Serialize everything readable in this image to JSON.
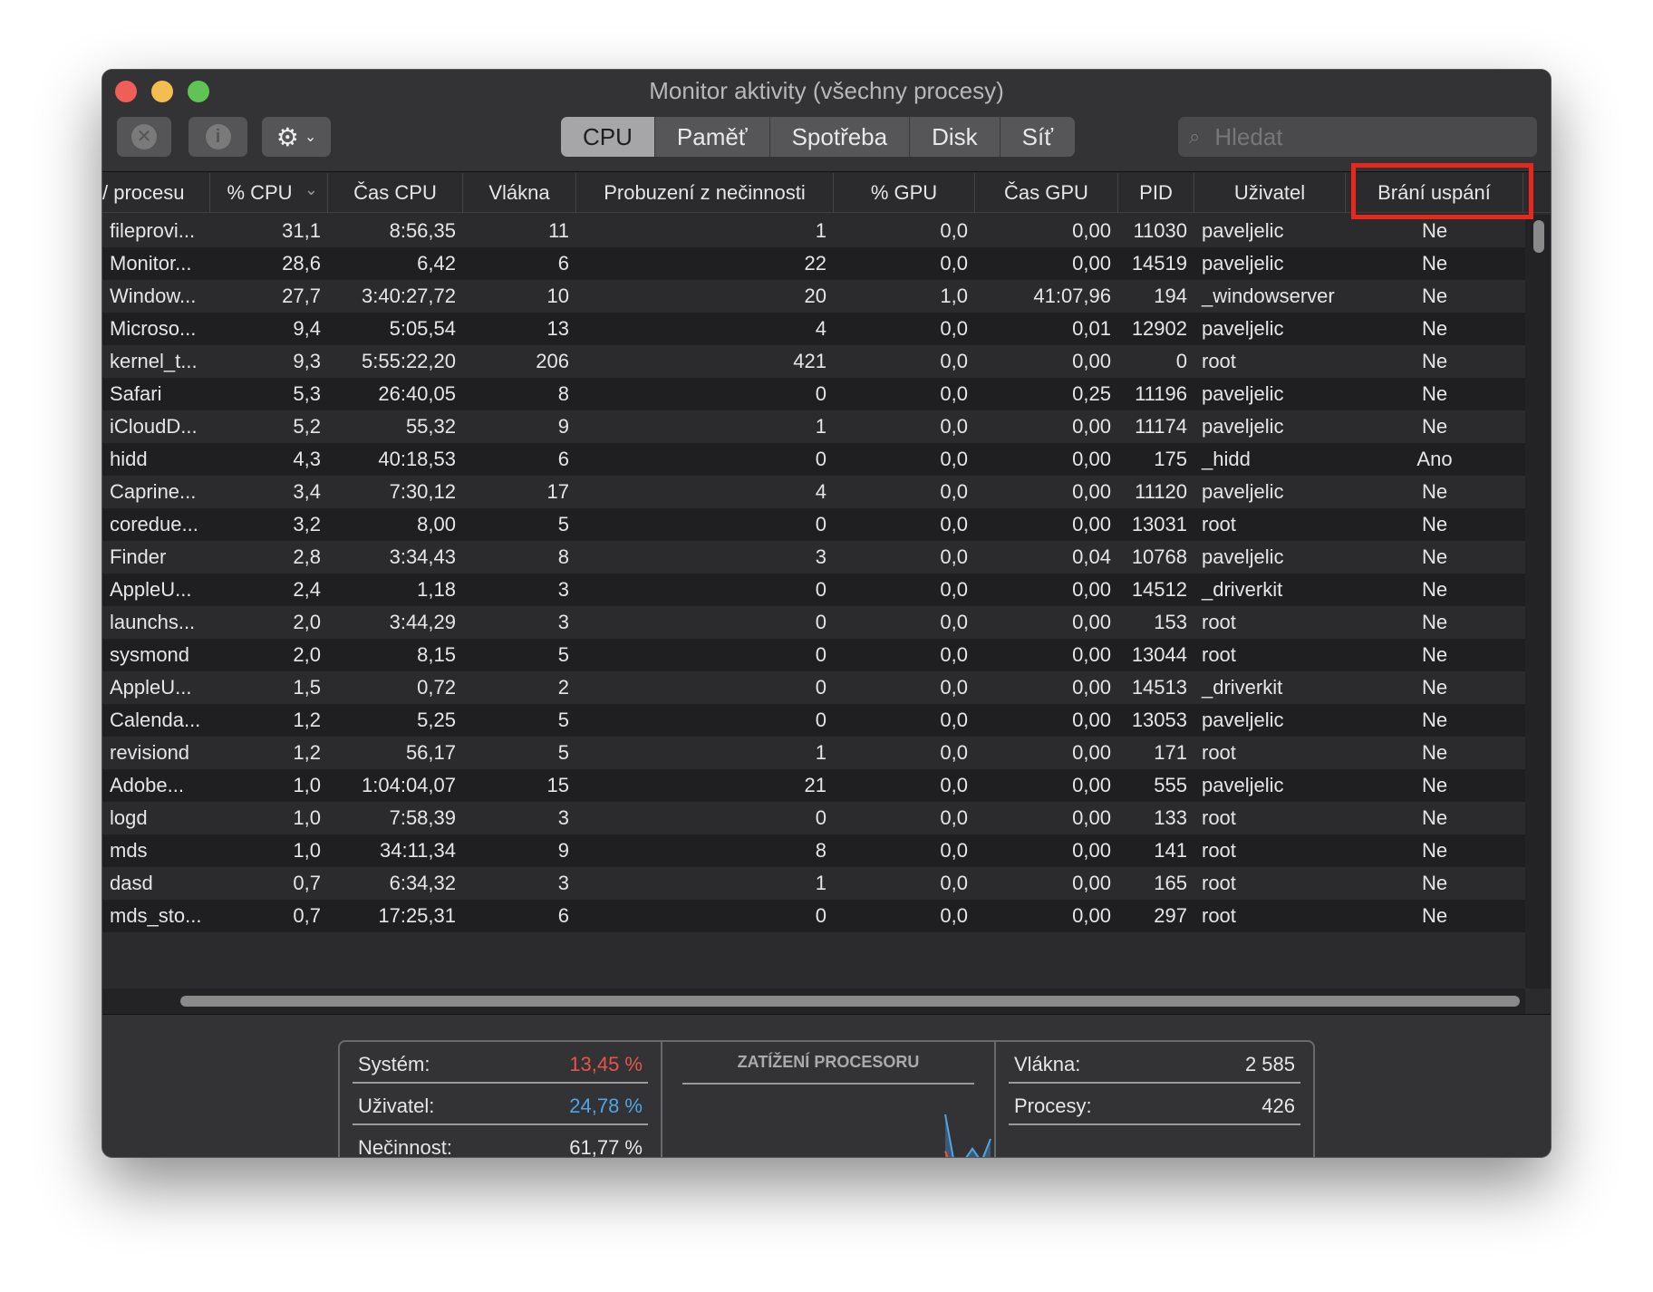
{
  "window": {
    "title": "Monitor aktivity (všechny procesy)"
  },
  "toolbar": {
    "stop_icon": "x-octagon-icon",
    "info_icon": "info-icon",
    "gear_icon": "gear-icon",
    "tabs": [
      {
        "label": "CPU",
        "active": true
      },
      {
        "label": "Paměť"
      },
      {
        "label": "Spotřeba"
      },
      {
        "label": "Disk"
      },
      {
        "label": "Síť"
      }
    ],
    "search_placeholder": "Hledat"
  },
  "columns": [
    "Název procesu",
    "% CPU",
    "Čas CPU",
    "Vlákna",
    "Probuzení z nečinnosti",
    "% GPU",
    "Čas GPU",
    "PID",
    "Uživatel",
    "Brání uspání"
  ],
  "columns_display": [
    "/ procesu",
    "% CPU",
    "Čas CPU",
    "Vlákna",
    "Probuzení z nečinnosti",
    "% GPU",
    "Čas GPU",
    "PID",
    "Uživatel",
    "Brání uspání"
  ],
  "rows": [
    [
      "fileprovi...",
      "31,1",
      "8:56,35",
      "11",
      "1",
      "0,0",
      "0,00",
      "11030",
      "paveljelic",
      "Ne"
    ],
    [
      "Monitor...",
      "28,6",
      "6,42",
      "6",
      "22",
      "0,0",
      "0,00",
      "14519",
      "paveljelic",
      "Ne"
    ],
    [
      "Window...",
      "27,7",
      "3:40:27,72",
      "10",
      "20",
      "1,0",
      "41:07,96",
      "194",
      "_windowserver",
      "Ne"
    ],
    [
      "Microso...",
      "9,4",
      "5:05,54",
      "13",
      "4",
      "0,0",
      "0,01",
      "12902",
      "paveljelic",
      "Ne"
    ],
    [
      "kernel_t...",
      "9,3",
      "5:55:22,20",
      "206",
      "421",
      "0,0",
      "0,00",
      "0",
      "root",
      "Ne"
    ],
    [
      "Safari",
      "5,3",
      "26:40,05",
      "8",
      "0",
      "0,0",
      "0,25",
      "11196",
      "paveljelic",
      "Ne"
    ],
    [
      "iCloudD...",
      "5,2",
      "55,32",
      "9",
      "1",
      "0,0",
      "0,00",
      "11174",
      "paveljelic",
      "Ne"
    ],
    [
      "hidd",
      "4,3",
      "40:18,53",
      "6",
      "0",
      "0,0",
      "0,00",
      "175",
      "_hidd",
      "Ano"
    ],
    [
      "Caprine...",
      "3,4",
      "7:30,12",
      "17",
      "4",
      "0,0",
      "0,00",
      "11120",
      "paveljelic",
      "Ne"
    ],
    [
      "coredue...",
      "3,2",
      "8,00",
      "5",
      "0",
      "0,0",
      "0,00",
      "13031",
      "root",
      "Ne"
    ],
    [
      "Finder",
      "2,8",
      "3:34,43",
      "8",
      "3",
      "0,0",
      "0,04",
      "10768",
      "paveljelic",
      "Ne"
    ],
    [
      "AppleU...",
      "2,4",
      "1,18",
      "3",
      "0",
      "0,0",
      "0,00",
      "14512",
      "_driverkit",
      "Ne"
    ],
    [
      "launchs...",
      "2,0",
      "3:44,29",
      "3",
      "0",
      "0,0",
      "0,00",
      "153",
      "root",
      "Ne"
    ],
    [
      "sysmond",
      "2,0",
      "8,15",
      "5",
      "0",
      "0,0",
      "0,00",
      "13044",
      "root",
      "Ne"
    ],
    [
      "AppleU...",
      "1,5",
      "0,72",
      "2",
      "0",
      "0,0",
      "0,00",
      "14513",
      "_driverkit",
      "Ne"
    ],
    [
      "Calenda...",
      "1,2",
      "5,25",
      "5",
      "0",
      "0,0",
      "0,00",
      "13053",
      "paveljelic",
      "Ne"
    ],
    [
      "revisiond",
      "1,2",
      "56,17",
      "5",
      "1",
      "0,0",
      "0,00",
      "171",
      "root",
      "Ne"
    ],
    [
      "Adobe...",
      "1,0",
      "1:04:04,07",
      "15",
      "21",
      "0,0",
      "0,00",
      "555",
      "paveljelic",
      "Ne"
    ],
    [
      "logd",
      "1,0",
      "7:58,39",
      "3",
      "0",
      "0,0",
      "0,00",
      "133",
      "root",
      "Ne"
    ],
    [
      "mds",
      "1,0",
      "34:11,34",
      "9",
      "8",
      "0,0",
      "0,00",
      "141",
      "root",
      "Ne"
    ],
    [
      "dasd",
      "0,7",
      "6:34,32",
      "3",
      "1",
      "0,0",
      "0,00",
      "165",
      "root",
      "Ne"
    ],
    [
      "mds_sto...",
      "0,7",
      "17:25,31",
      "6",
      "0",
      "0,0",
      "0,00",
      "297",
      "root",
      "Ne"
    ]
  ],
  "summary": {
    "system_label": "Systém:",
    "system_value": "13,45 %",
    "system_color": "#e5564a",
    "user_label": "Uživatel:",
    "user_value": "24,78 %",
    "user_color": "#4ea6e6",
    "idle_label": "Nečinnost:",
    "idle_value": "61,77 %",
    "chart_title": "ZATÍŽENÍ PROCESORU",
    "threads_label": "Vlákna:",
    "threads_value": "2 585",
    "processes_label": "Procesy:",
    "processes_value": "426",
    "load_user": [
      100,
      40,
      42,
      58,
      42,
      70
    ],
    "load_system": [
      55,
      25,
      28,
      35,
      28,
      38
    ]
  }
}
